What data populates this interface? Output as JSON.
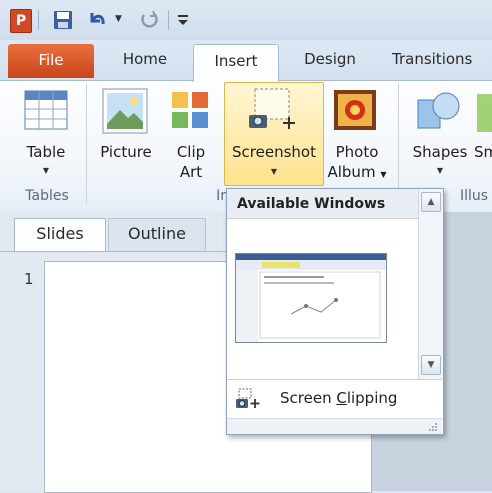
{
  "quick_access": {
    "app_logo": "P",
    "icons": [
      "save-icon",
      "undo-icon",
      "redo-icon",
      "customize-icon"
    ]
  },
  "tabs": {
    "file": "File",
    "home": "Home",
    "insert": "Insert",
    "design": "Design",
    "transitions": "Transitions"
  },
  "ribbon": {
    "table": "Table",
    "picture": "Picture",
    "clip_art_1": "Clip",
    "clip_art_2": "Art",
    "screenshot": "Screenshot",
    "photo_album_1": "Photo",
    "photo_album_2": "Album",
    "shapes": "Shapes",
    "smartart_partial": "Sm",
    "groups": {
      "tables": "Tables",
      "images_partial": "Im",
      "illustrations_partial": "Illus"
    }
  },
  "pane": {
    "tab_slides": "Slides",
    "tab_outline": "Outline",
    "slide_number": "1"
  },
  "dropdown": {
    "header": "Available Windows",
    "screen_clipping_prefix": "Screen ",
    "screen_clipping_accel": "C",
    "screen_clipping_suffix": "lipping"
  },
  "colors": {
    "file_tab": "#d9562a",
    "highlight": "#ffe28f",
    "accent_border": "#a7bbd3"
  }
}
